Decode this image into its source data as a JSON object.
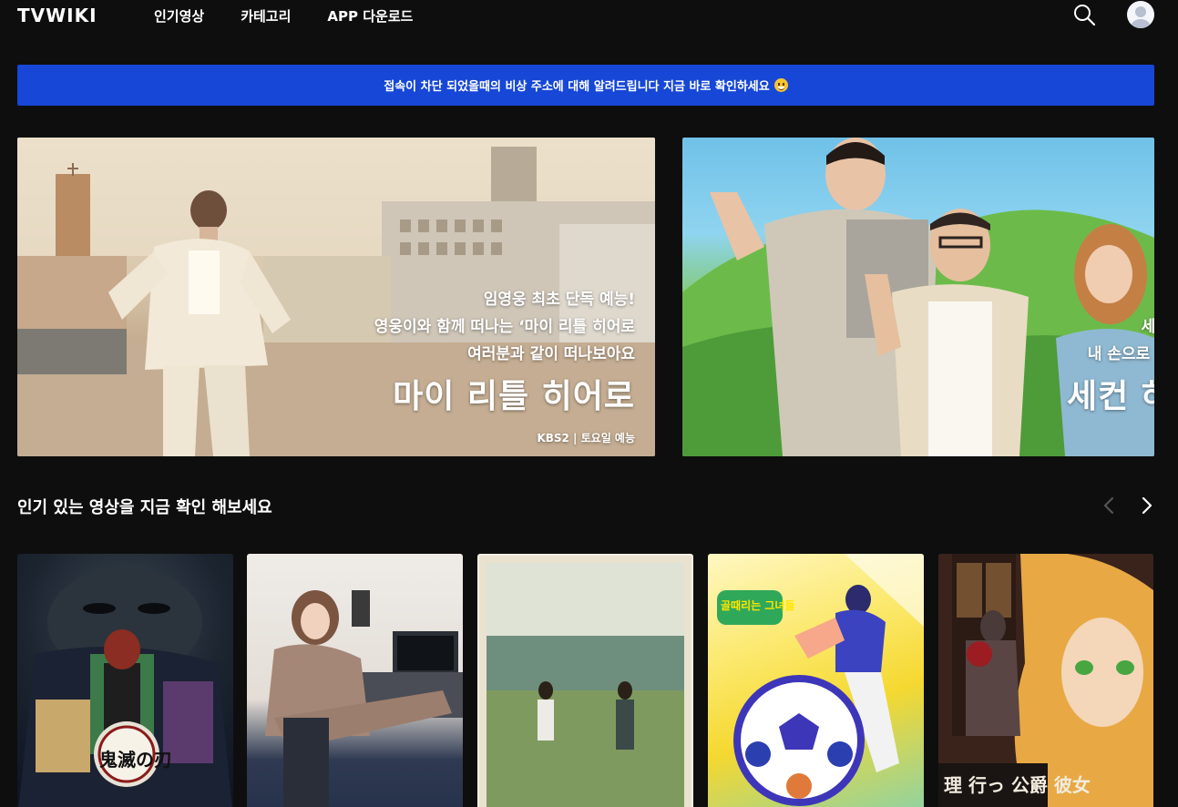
{
  "header": {
    "logo": "TVWIKI",
    "nav": [
      "인기영상",
      "카테고리",
      "APP 다운로드"
    ]
  },
  "notice": {
    "text": "접속이 차단 되었을때의 비상 주소에 대해 알려드립니다 지금 바로 확인하세요"
  },
  "banners": [
    {
      "lines": [
        "임영웅 최초 단독 예능!",
        "영웅이와 함께 떠나는 ‘마이 리틀 히어로",
        "여러분과 같이 떠나보아요"
      ],
      "title": "마이 리틀 히어로",
      "meta": "KBS2 | 토요일 예능"
    },
    {
      "lines": [
        "세컨 하우",
        "내 손으로 직접 만"
      ],
      "title": "세컨 하우"
    }
  ],
  "section": {
    "title": "인기 있는 영상을 지금 확인 해보세요"
  },
  "posters": [
    {
      "text": "鬼滅の刃"
    },
    {
      "text": ""
    },
    {
      "text": ""
    },
    {
      "text": "골때리는 그녀들"
    },
    {
      "text": "理 行っ 公爵 彼女"
    }
  ],
  "colors": {
    "background": "#0e0e0e",
    "notice": "#1647d6"
  }
}
